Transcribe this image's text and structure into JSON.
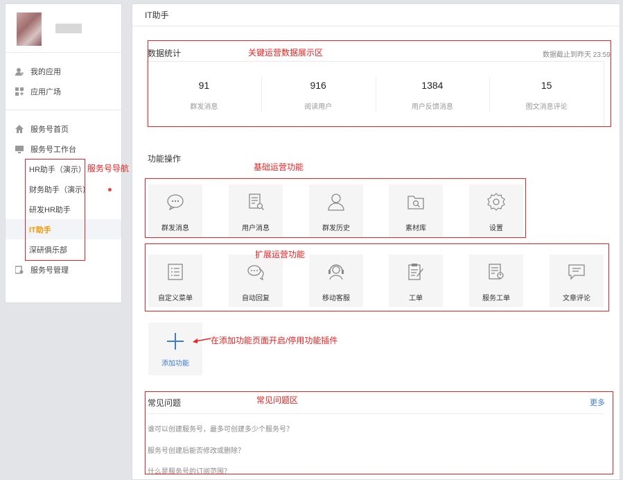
{
  "sidebar": {
    "top_items": [
      {
        "label": "我的应用",
        "icon": "user-apps-icon"
      },
      {
        "label": "应用广场",
        "icon": "grid-plus-icon"
      }
    ],
    "service_items": [
      {
        "label": "服务号首页",
        "icon": "home-icon"
      },
      {
        "label": "服务号工作台",
        "icon": "monitor-icon"
      }
    ],
    "sub_items": [
      {
        "label": "HR助手（演示）"
      },
      {
        "label": "财务助手（演示）"
      },
      {
        "label": "研发HR助手"
      },
      {
        "label": "IT助手"
      },
      {
        "label": "深研俱乐部"
      }
    ],
    "manage_item": {
      "label": "服务号管理",
      "icon": "settings-doc-icon"
    }
  },
  "main": {
    "title": "IT助手",
    "stats": {
      "title": "数据统计",
      "note": "数据截止到昨天 23:59",
      "items": [
        {
          "value": "91",
          "label": "群发消息"
        },
        {
          "value": "916",
          "label": "阅读用户"
        },
        {
          "value": "1384",
          "label": "用户反馈消息"
        },
        {
          "value": "15",
          "label": "图文消息评论"
        }
      ]
    },
    "functions": {
      "title": "功能操作",
      "basic": [
        {
          "label": "群发消息",
          "icon": "chat-bubble-icon"
        },
        {
          "label": "用户消息",
          "icon": "doc-search-icon"
        },
        {
          "label": "群发历史",
          "icon": "person-icon"
        },
        {
          "label": "素材库",
          "icon": "folder-search-icon"
        },
        {
          "label": "设置",
          "icon": "gear-icon"
        }
      ],
      "extended": [
        {
          "label": "自定义菜单",
          "icon": "list-icon"
        },
        {
          "label": "自动回复",
          "icon": "double-chat-icon"
        },
        {
          "label": "移动客服",
          "icon": "headset-icon"
        },
        {
          "label": "工单",
          "icon": "clipboard-pen-icon"
        },
        {
          "label": "服务工单",
          "icon": "doc-user-icon"
        },
        {
          "label": "文章评论",
          "icon": "comment-lines-icon"
        }
      ],
      "add_label": "添加功能"
    },
    "faq": {
      "title": "常见问题",
      "more": "更多",
      "questions": [
        "谁可以创建服务号，最多可创建多少个服务号？",
        "服务号创建后能否修改或删除？",
        "什么是服务号的订阅范围？"
      ]
    }
  },
  "annotations": {
    "stats_area": "关键运营数据展示区",
    "nav": "服务号导航",
    "basic": "基础运营功能",
    "extended": "扩展运营功能",
    "add": "在添加功能页面开启/停用功能插件",
    "faq": "常见问题区"
  },
  "colors": {
    "accent": "#f39800",
    "link": "#3e7bd7",
    "annotation": "#ee2222"
  }
}
